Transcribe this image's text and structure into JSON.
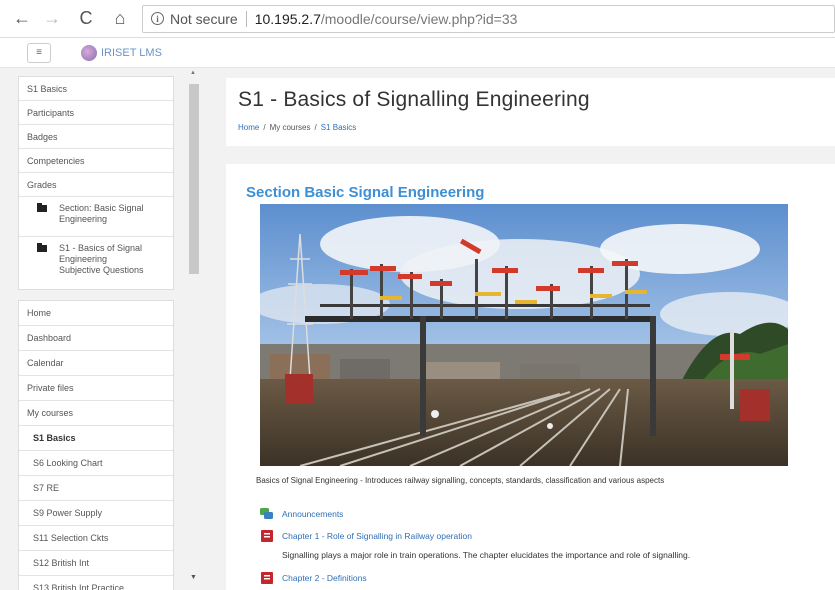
{
  "browser": {
    "back": "←",
    "forward": "→",
    "reload": "C",
    "home": "⌂",
    "info": "i",
    "security": "Not secure",
    "url_host": "10.195.2.7",
    "url_path": "/moodle/course/view.php?id=33"
  },
  "navbar": {
    "menu_glyph": "≡",
    "brand": "IRISET LMS"
  },
  "drawer": {
    "course_items": [
      "S1 Basics",
      "Participants",
      "Badges",
      "Competencies",
      "Grades"
    ],
    "folders": [
      [
        "Section: Basic Signal",
        "Engineering"
      ],
      [
        "S1 - Basics of Signal",
        "Engineering",
        "Subjective Questions"
      ]
    ],
    "site_items": [
      "Home",
      "Dashboard",
      "Calendar",
      "Private files",
      "My courses"
    ],
    "courses": [
      "S1 Basics",
      "S6 Looking Chart",
      "S7 RE",
      "S9 Power Supply",
      "S11 Selection Ckts",
      "S12 British Int",
      "S13 British Int Practice"
    ],
    "scroll_up": "▲",
    "scroll_down": "▼"
  },
  "header": {
    "title": "S1 - Basics of Signalling Engineering",
    "breadcrumb": [
      "Home",
      "My courses",
      "S1 Basics"
    ],
    "breadcrumb_sep": "/"
  },
  "section": {
    "title": "Section  Basic Signal Engineering",
    "summary": "Basics of Signal Engineering - Introduces railway signalling, concepts, standards, classification and various aspects",
    "activities": [
      {
        "label": "Announcements",
        "icon": "forum-icon"
      },
      {
        "label": "Chapter 1 - Role of Signalling in Railway operation",
        "icon": "pdf-icon"
      },
      {
        "label": "Chapter 2 - Definitions",
        "icon": "pdf-icon"
      }
    ],
    "chapter1_desc": "Signalling plays a major role in train operations. The chapter elucidates the importance and role of signalling."
  },
  "colors": {
    "link": "#2f6fb8",
    "section_title": "#3d8fd6",
    "drawer_bg": "#f2f2f2"
  }
}
